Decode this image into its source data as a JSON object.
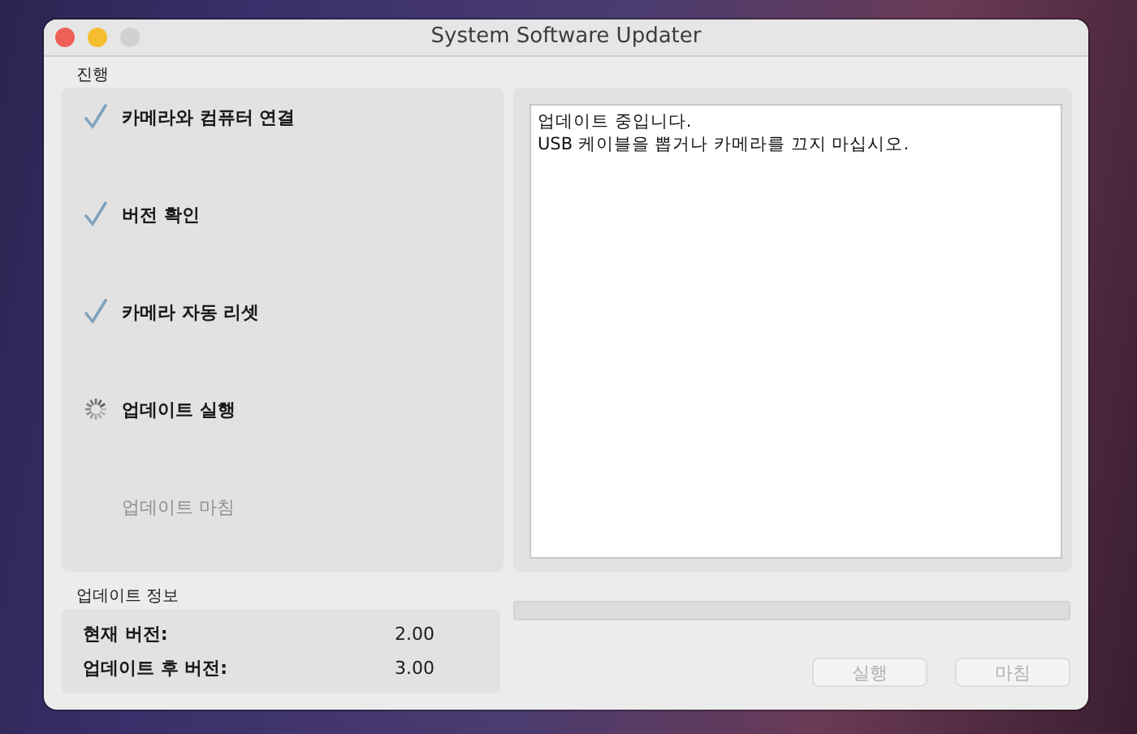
{
  "window": {
    "title": "System Software Updater"
  },
  "progress": {
    "title": "진행",
    "steps": [
      {
        "label": "카메라와 컴퓨터 연결",
        "kind": "done"
      },
      {
        "label": "버전 확인",
        "kind": "done"
      },
      {
        "label": "카메라 자동 리셋",
        "kind": "done"
      },
      {
        "label": "업데이트 실행",
        "kind": "running"
      },
      {
        "label": "업데이트 마침",
        "kind": "pending"
      }
    ]
  },
  "message": {
    "lines": [
      "업데이트 중입니다.",
      "USB 케이블을 뽑거나 카메라를 끄지 마십시오."
    ]
  },
  "info": {
    "title": "업데이트 정보",
    "rows": [
      {
        "label": "현재 버전:",
        "value": "2.00"
      },
      {
        "label": "업데이트 후 버전:",
        "value": "3.00"
      }
    ]
  },
  "progress_bar": {
    "level": 0
  },
  "buttons": [
    {
      "label": "실행",
      "disabled": true
    },
    {
      "label": "마침",
      "disabled": true
    }
  ]
}
